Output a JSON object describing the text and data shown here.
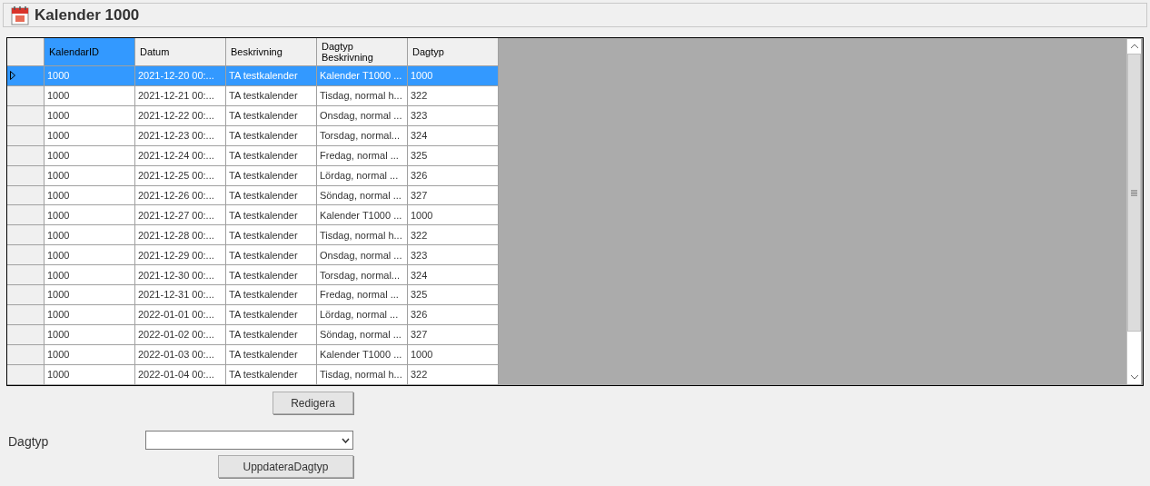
{
  "window": {
    "title": "Kalender 1000"
  },
  "table": {
    "columns": [
      {
        "label": "KalendarID",
        "selected": true
      },
      {
        "label": "Datum",
        "selected": false
      },
      {
        "label": "Beskrivning",
        "selected": false
      },
      {
        "label": "Dagtyp Beskrivning",
        "selected": false
      },
      {
        "label": "Dagtyp",
        "selected": false
      }
    ],
    "rows": [
      {
        "selected": true,
        "cells": [
          "1000",
          "2021-12-20 00:...",
          "TA testkalender",
          "Kalender T1000 ...",
          "1000"
        ]
      },
      {
        "selected": false,
        "cells": [
          "1000",
          "2021-12-21 00:...",
          "TA testkalender",
          "Tisdag, normal h...",
          "322"
        ]
      },
      {
        "selected": false,
        "cells": [
          "1000",
          "2021-12-22 00:...",
          "TA testkalender",
          "Onsdag, normal ...",
          "323"
        ]
      },
      {
        "selected": false,
        "cells": [
          "1000",
          "2021-12-23 00:...",
          "TA testkalender",
          "Torsdag, normal...",
          "324"
        ]
      },
      {
        "selected": false,
        "cells": [
          "1000",
          "2021-12-24 00:...",
          "TA testkalender",
          "Fredag, normal ...",
          "325"
        ]
      },
      {
        "selected": false,
        "cells": [
          "1000",
          "2021-12-25 00:...",
          "TA testkalender",
          "Lördag, normal ...",
          "326"
        ]
      },
      {
        "selected": false,
        "cells": [
          "1000",
          "2021-12-26 00:...",
          "TA testkalender",
          "Söndag, normal ...",
          "327"
        ]
      },
      {
        "selected": false,
        "cells": [
          "1000",
          "2021-12-27 00:...",
          "TA testkalender",
          "Kalender T1000 ...",
          "1000"
        ]
      },
      {
        "selected": false,
        "cells": [
          "1000",
          "2021-12-28 00:...",
          "TA testkalender",
          "Tisdag, normal h...",
          "322"
        ]
      },
      {
        "selected": false,
        "cells": [
          "1000",
          "2021-12-29 00:...",
          "TA testkalender",
          "Onsdag, normal ...",
          "323"
        ]
      },
      {
        "selected": false,
        "cells": [
          "1000",
          "2021-12-30 00:...",
          "TA testkalender",
          "Torsdag, normal...",
          "324"
        ]
      },
      {
        "selected": false,
        "cells": [
          "1000",
          "2021-12-31 00:...",
          "TA testkalender",
          "Fredag, normal ...",
          "325"
        ]
      },
      {
        "selected": false,
        "cells": [
          "1000",
          "2022-01-01 00:...",
          "TA testkalender",
          "Lördag, normal ...",
          "326"
        ]
      },
      {
        "selected": false,
        "cells": [
          "1000",
          "2022-01-02 00:...",
          "TA testkalender",
          "Söndag, normal ...",
          "327"
        ]
      },
      {
        "selected": false,
        "cells": [
          "1000",
          "2022-01-03 00:...",
          "TA testkalender",
          "Kalender T1000 ...",
          "1000"
        ]
      },
      {
        "selected": false,
        "cells": [
          "1000",
          "2022-01-04 00:...",
          "TA testkalender",
          "Tisdag, normal h...",
          "322"
        ]
      }
    ]
  },
  "edit_button": "Redigera",
  "dagtyp_label": "Dagtyp",
  "update_button": "UppdateraDagtyp"
}
